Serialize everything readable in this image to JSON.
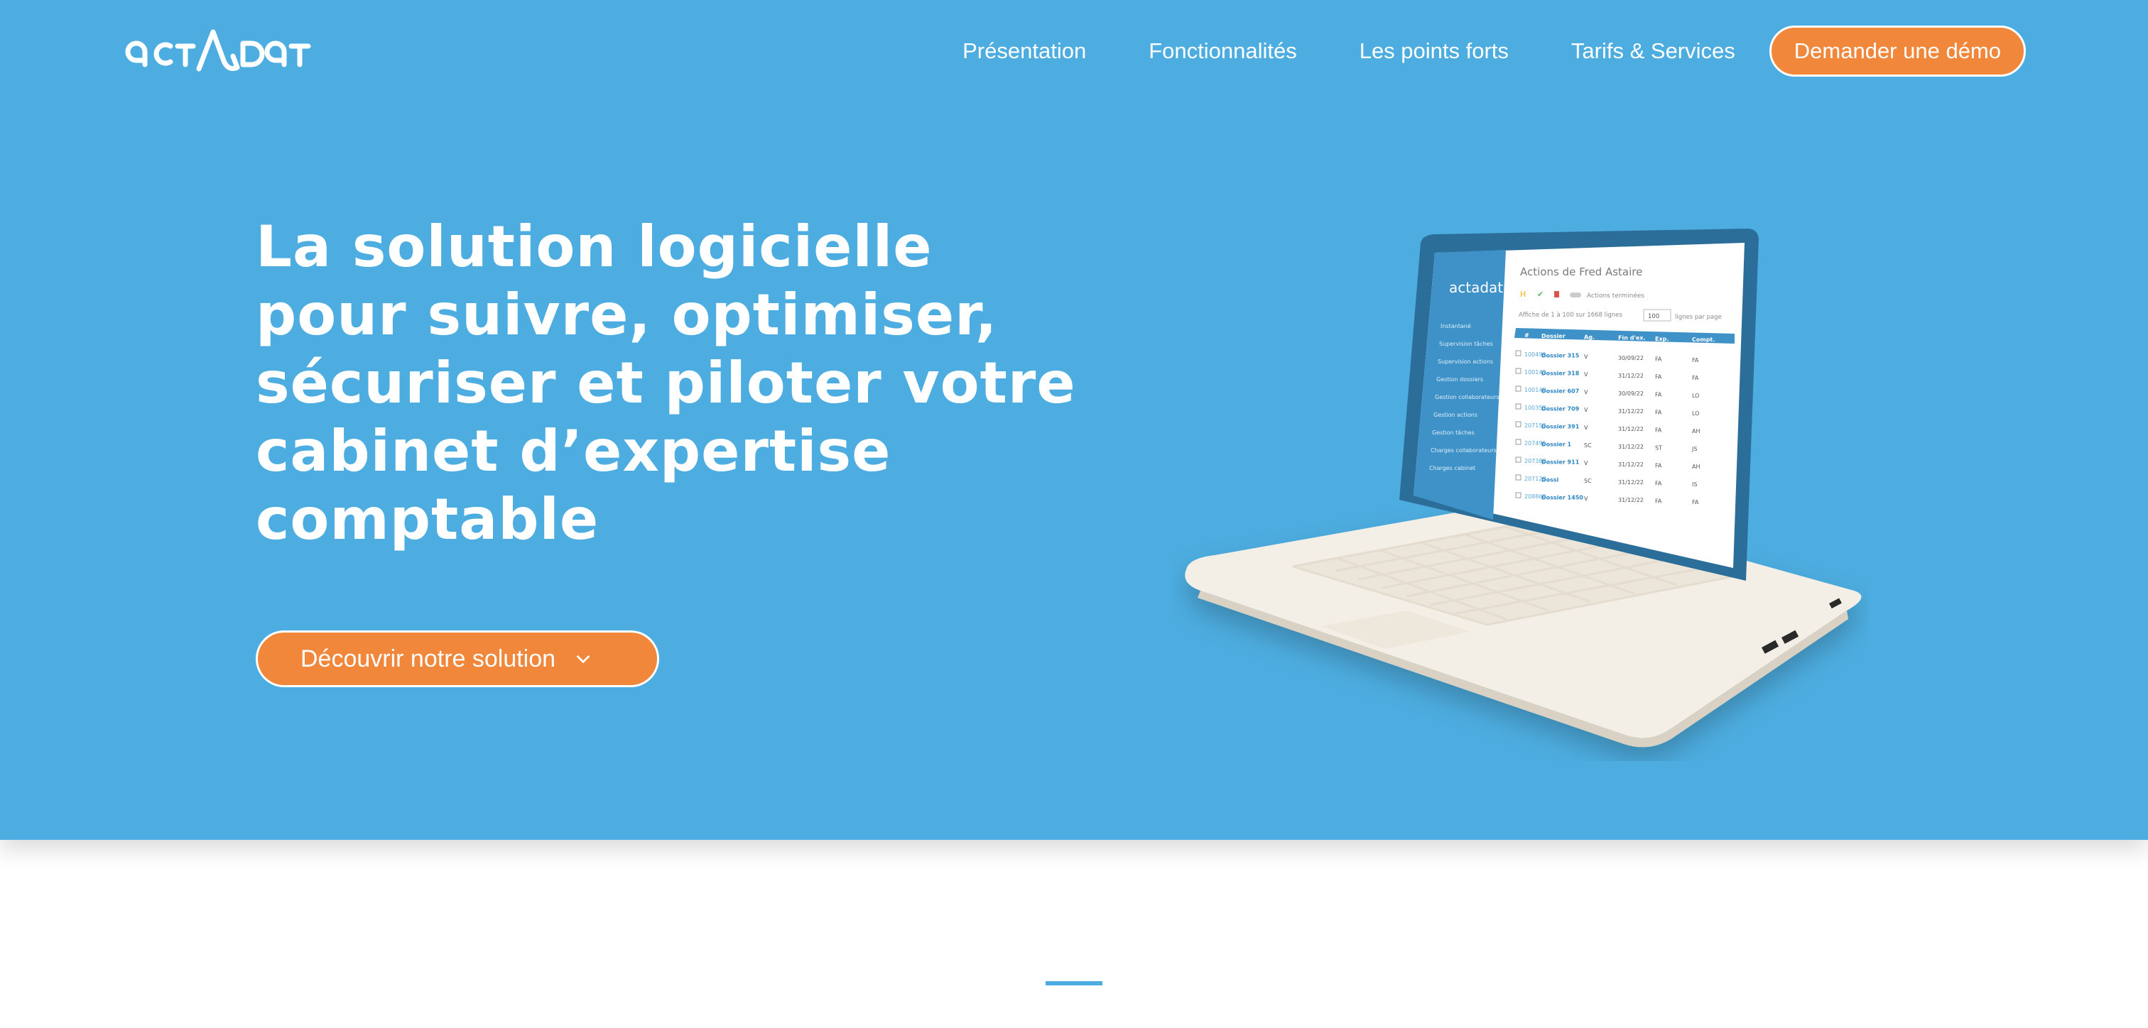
{
  "brand": {
    "name": "actadat"
  },
  "nav": {
    "items": [
      {
        "label": "Présentation"
      },
      {
        "label": "Fonctionnalités"
      },
      {
        "label": "Les points forts"
      },
      {
        "label": "Tarifs & Services"
      }
    ],
    "cta_label": "Demander une démo"
  },
  "hero": {
    "headline_lines": [
      "La solution logicielle",
      "pour suivre, optimiser,",
      "sécuriser et piloter votre",
      "cabinet d’expertise",
      "comptable"
    ],
    "cta_label": "Découvrir notre solution",
    "cta_icon": "chevron-down-icon"
  },
  "laptop_screen": {
    "app_logo": "actadat",
    "title": "Actions de Fred Astaire",
    "toggle_label": "Actions terminées",
    "info_text": "Affiche de 1 à 100 sur 1668 lignes",
    "page_size": "100",
    "page_size_suffix": "lignes par page",
    "columns": [
      "#",
      "Dossier",
      "Ag.",
      "Fin d'ex.",
      "Exp.",
      "Compt."
    ],
    "rows": [
      [
        "100499",
        "Dossier 315",
        "V",
        "30/09/22",
        "FA",
        "FA"
      ],
      [
        "100143",
        "Dossier 318",
        "V",
        "31/12/22",
        "FA",
        "FA"
      ],
      [
        "100148",
        "Dossier 607",
        "V",
        "30/09/22",
        "FA",
        "LO"
      ],
      [
        "100353",
        "Dossier 709",
        "V",
        "31/12/22",
        "FA",
        "LO"
      ],
      [
        "207153",
        "Dossier 391",
        "V",
        "31/12/22",
        "FA",
        "AH"
      ],
      [
        "207496",
        "Dossier 1",
        "SC",
        "31/12/22",
        "ST",
        "JS"
      ],
      [
        "207380",
        "Dossier 911",
        "V",
        "31/12/22",
        "FA",
        "AH"
      ],
      [
        "207129",
        "Dossi",
        "SC",
        "31/12/22",
        "FA",
        "IS"
      ],
      [
        "208860",
        "Dossier 1450",
        "V",
        "31/12/22",
        "FA",
        "FA"
      ]
    ],
    "sidebar_items": [
      "Instantané",
      "Supervision tâches",
      "Supervision actions",
      "Gestion dossiers",
      "Gestion collaborateurs",
      "Gestion actions",
      "Gestion tâches",
      "Charges collaborateurs",
      "Charges cabinet"
    ]
  },
  "colors": {
    "hero_bg": "#4dade0",
    "accent": "#f0873a",
    "text_on_hero": "#ffffff",
    "page_bg": "#ffffff"
  }
}
